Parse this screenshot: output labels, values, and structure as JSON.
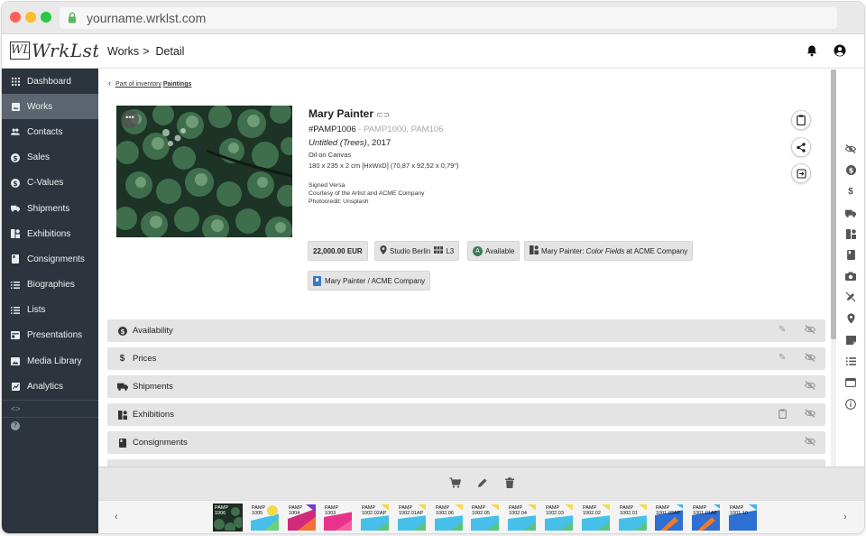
{
  "browser": {
    "url": "yourname.wrklst.com"
  },
  "app": {
    "logo_mark": "WL",
    "logo_text": "WrkLst"
  },
  "sidebar": {
    "items": [
      {
        "label": "Dashboard",
        "icon": "grid-icon"
      },
      {
        "label": "Works",
        "icon": "image-icon",
        "active": true
      },
      {
        "label": "Contacts",
        "icon": "people-icon"
      },
      {
        "label": "Sales",
        "icon": "dollar-circle-icon"
      },
      {
        "label": "C-Values",
        "icon": "dollar-circle-icon"
      },
      {
        "label": "Shipments",
        "icon": "truck-icon"
      },
      {
        "label": "Exhibitions",
        "icon": "exhibition-icon"
      },
      {
        "label": "Consignments",
        "icon": "book-icon"
      },
      {
        "label": "Biographies",
        "icon": "list-icon"
      },
      {
        "label": "Lists",
        "icon": "list-icon"
      },
      {
        "label": "Presentations",
        "icon": "presentation-icon"
      },
      {
        "label": "Media Library",
        "icon": "media-icon"
      },
      {
        "label": "Analytics",
        "icon": "analytics-icon"
      }
    ],
    "collapse_glyph": "<>",
    "help_glyph": "?"
  },
  "header": {
    "section": "Works",
    "chevron": ">",
    "page": "Detail"
  },
  "back": {
    "prefix": "Part of inventory",
    "inventory": "Paintings"
  },
  "work": {
    "artist": "Mary Painter",
    "inventory_number": "#PAMP1006",
    "alt_numbers": "- PAMP1000, PAM106",
    "title": "Untitled (Trees)",
    "year": ", 2017",
    "medium": "Oil on Canvas",
    "dimensions": "180 x 235 x 2 cm [HxWxD] (70,87 x 92,52 x 0,79\")",
    "signed": "Signed Versa",
    "courtesy": "Courtesy of the Artist and ACME Company",
    "photocredit": "Photocredit: Unsplash"
  },
  "tags": {
    "price": "22,000.00 EUR",
    "location": "Studio Berlin",
    "location_code": "L3",
    "availability_badge": "A",
    "availability": "Available",
    "exhibition_prefix": "Mary Painter: ",
    "exhibition_title": "Color Fields",
    "exhibition_suffix": " at ACME Company",
    "consignment": "Mary Painter / ACME Company"
  },
  "sections": [
    {
      "label": "Availability"
    },
    {
      "label": "Prices"
    },
    {
      "label": "Shipments"
    },
    {
      "label": "Exhibitions"
    },
    {
      "label": "Consignments"
    }
  ],
  "filmstrip": [
    {
      "line1": "PAMP",
      "line2": "1006",
      "selected": true
    },
    {
      "line1": "PAMP",
      "line2": "1005"
    },
    {
      "line1": "PAMP",
      "line2": "1004"
    },
    {
      "line1": "PAMP",
      "line2": "1003"
    },
    {
      "line1": "PAMP",
      "line2": "1002.02AP"
    },
    {
      "line1": "PAMP",
      "line2": "1002.01AP"
    },
    {
      "line1": "PAMP",
      "line2": "1002.06"
    },
    {
      "line1": "PAMP",
      "line2": "1002.05"
    },
    {
      "line1": "PAMP",
      "line2": "1002.04"
    },
    {
      "line1": "PAMP",
      "line2": "1002.03"
    },
    {
      "line1": "PAMP",
      "line2": "1002.02"
    },
    {
      "line1": "PAMP",
      "line2": "1002.01"
    },
    {
      "line1": "PAMP",
      "line2": "1001.02AP"
    },
    {
      "line1": "PAMP",
      "line2": "1001.01AP"
    },
    {
      "line1": "PAMP",
      "line2": "1001.10"
    }
  ],
  "colors": {
    "sidebar_bg": "#2c353e",
    "sidebar_active": "#5c6670",
    "section_bg": "#e4e4e4",
    "available_badge": "#3a7c55",
    "consignment_badge": "#3b78c4"
  }
}
